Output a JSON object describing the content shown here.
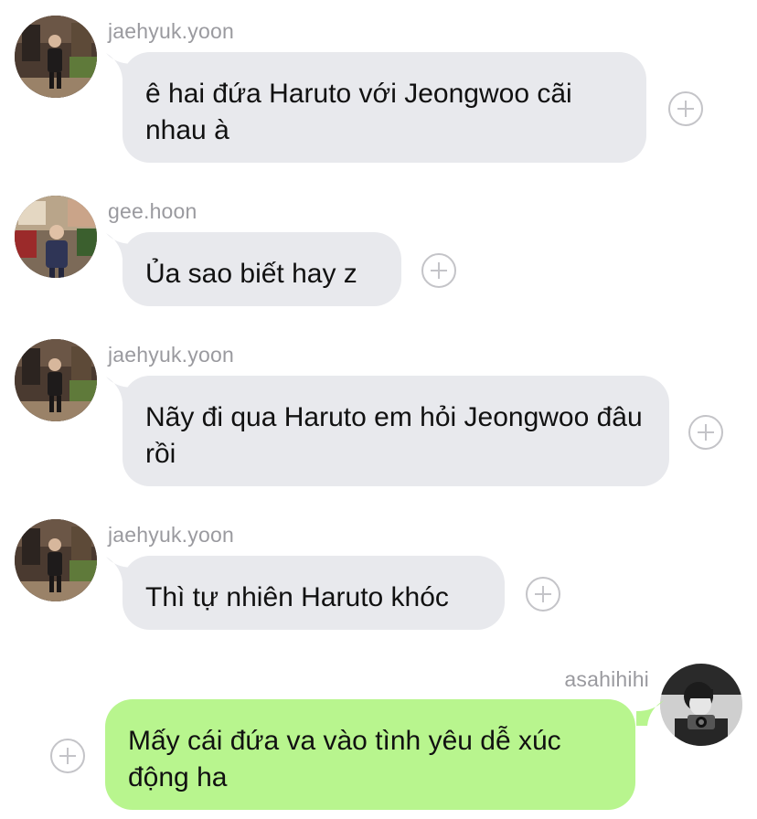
{
  "messages": [
    {
      "sender": "jaehyuk.yoon",
      "direction": "incoming",
      "text": "ê hai đứa Haruto với Jeongwoo cãi nhau à",
      "avatar_icon": "jaehyuk-avatar-icon"
    },
    {
      "sender": "gee.hoon",
      "direction": "incoming",
      "text": "Ủa sao biết hay z",
      "avatar_icon": "geehoon-avatar-icon"
    },
    {
      "sender": "jaehyuk.yoon",
      "direction": "incoming",
      "text": "Nãy đi qua Haruto em hỏi Jeongwoo đâu rồi",
      "avatar_icon": "jaehyuk-avatar-icon"
    },
    {
      "sender": "jaehyuk.yoon",
      "direction": "incoming",
      "text": "Thì tự nhiên Haruto khóc",
      "avatar_icon": "jaehyuk-avatar-icon"
    },
    {
      "sender": "asahihihi",
      "direction": "outgoing",
      "text": "Mấy cái đứa va vào tình yêu dễ xúc động ha",
      "avatar_icon": "asahi-avatar-icon"
    }
  ],
  "reaction_icon": "add-reaction-icon",
  "colors": {
    "incoming_bubble": "#e8e9ed",
    "outgoing_bubble": "#b8f58e",
    "username": "#9a9a9f",
    "reaction": "#c4c4c8"
  }
}
